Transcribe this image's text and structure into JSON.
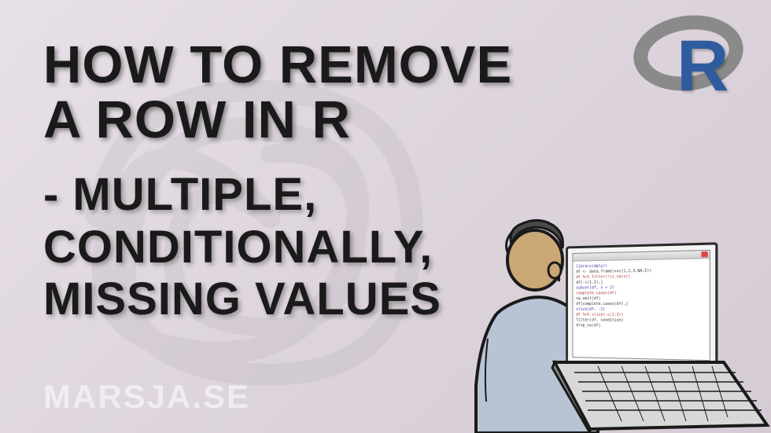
{
  "title": {
    "line1": "HOW TO REMOVE",
    "line2": "A ROW IN R"
  },
  "subtitle": {
    "line1": "- MULTIPLE,",
    "line2": "CONDITIONALLY,",
    "line3": "MISSING VALUES"
  },
  "watermark": "MARSJA.SE",
  "r_logo_letter": "R",
  "code_snippets": [
    "library(dplyr)",
    "df <- data.frame(x=c(1,2,3,NA,5))",
    "df %>% filter(!is.na(x))",
    "df[-c(1,3),]",
    "subset(df, x > 2)",
    "",
    "complete.cases(df)",
    "na.omit(df)",
    "df[complete.cases(df),]",
    "",
    "slice(df, -1)",
    "df %>% slice(-c(1:3))",
    "filter(df, condition)",
    "drop_na(df)"
  ]
}
